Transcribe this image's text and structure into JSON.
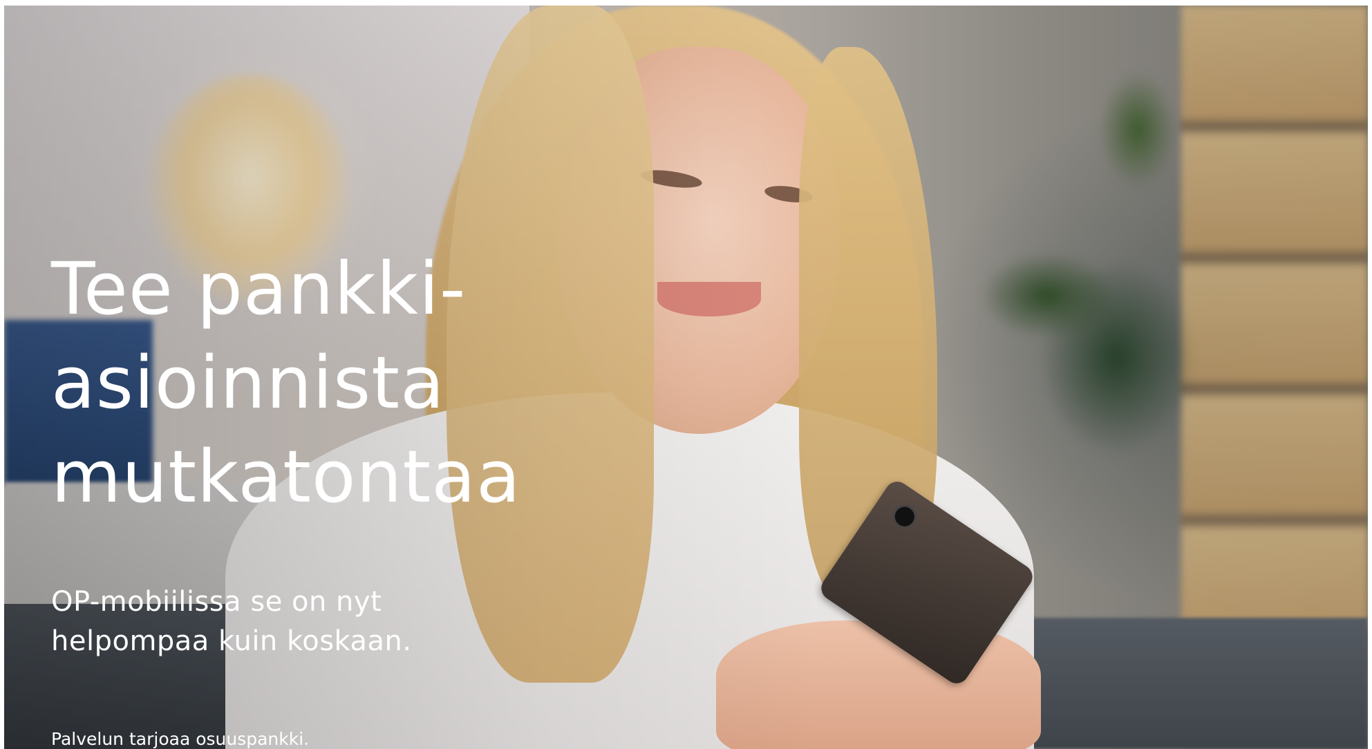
{
  "banner": {
    "headline_lines": [
      "Tee pankki-",
      "asioinnista",
      "mutkatontaa"
    ],
    "subtext_lines": [
      "OP-mobiilissa se on nyt",
      "helpompaa kuin koskaan."
    ],
    "footer_note": "Palvelun tarjoaa osuuspankki."
  },
  "colors": {
    "text": "#ffffff",
    "page_background": "#ffffff"
  }
}
